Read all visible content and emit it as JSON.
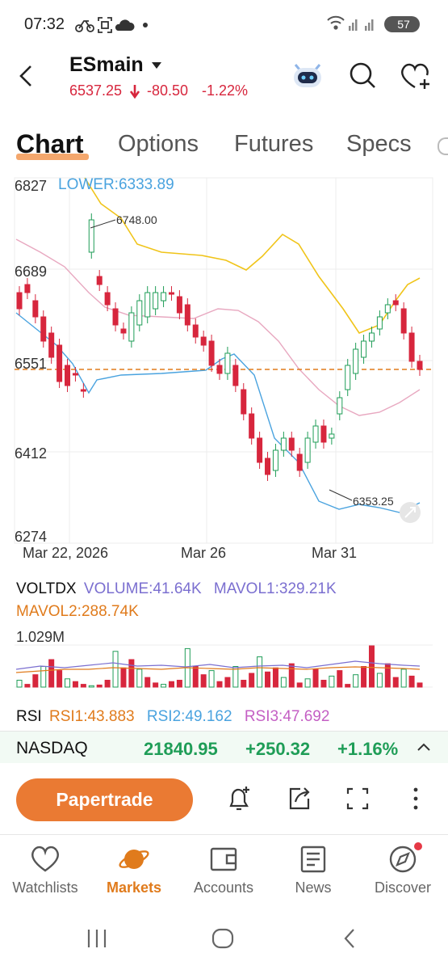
{
  "status_bar": {
    "time": "07:32",
    "battery": "57"
  },
  "header": {
    "symbol": "ESmain",
    "price": "6537.25",
    "change": "-80.50",
    "change_pct": "-1.22%",
    "icons": [
      "back-arrow-icon",
      "caret-down-icon",
      "robot-assistant-icon",
      "search-icon",
      "heart-plus-icon"
    ]
  },
  "tabs": [
    {
      "label": "Chart",
      "active": true
    },
    {
      "label": "Options",
      "active": false
    },
    {
      "label": "Futures",
      "active": false
    },
    {
      "label": "Specs",
      "active": false
    }
  ],
  "chart": {
    "indicator_label": "LOWER:6333.89",
    "y_ticks": [
      "6827",
      "6689",
      "6551",
      "6412",
      "6274"
    ],
    "x_ticks": [
      "Mar 22, 2026",
      "Mar 26",
      "Mar 31"
    ],
    "high_annotation": "6748.00",
    "low_annotation": "6353.25",
    "current_price_line": 6537.25,
    "colors": {
      "up": "#1f9d57",
      "down": "#d7263d",
      "upper_band": "#f0c419",
      "middle_band": "#e8a8c0",
      "lower_band": "#4aa3df",
      "price_line": "#e07b1c"
    }
  },
  "volume": {
    "title": "VOLTDX",
    "volume_label": "VOLUME:41.64K",
    "mavol1_label": "MAVOL1:329.21K",
    "mavol2_label": "MAVOL2:288.74K",
    "max_label": "1.029M"
  },
  "rsi": {
    "title": "RSI",
    "rsi1": "RSI1:43.883",
    "rsi2": "RSI2:49.162",
    "rsi3": "RSI3:47.692"
  },
  "ticker": {
    "name": "NASDAQ",
    "value": "21840.95",
    "change": "+250.32",
    "change_pct": "+1.16%"
  },
  "actions": {
    "papertrade_label": "Papertrade",
    "icons": [
      "alert-bell-plus-icon",
      "share-icon",
      "fullscreen-icon",
      "more-vertical-icon"
    ]
  },
  "bottom_nav": [
    {
      "label": "Watchlists",
      "icon": "heart-icon",
      "active": false
    },
    {
      "label": "Markets",
      "icon": "planet-icon",
      "active": true
    },
    {
      "label": "Accounts",
      "icon": "wallet-icon",
      "active": false
    },
    {
      "label": "News",
      "icon": "news-icon",
      "active": false
    },
    {
      "label": "Discover",
      "icon": "compass-icon",
      "active": false
    }
  ]
}
